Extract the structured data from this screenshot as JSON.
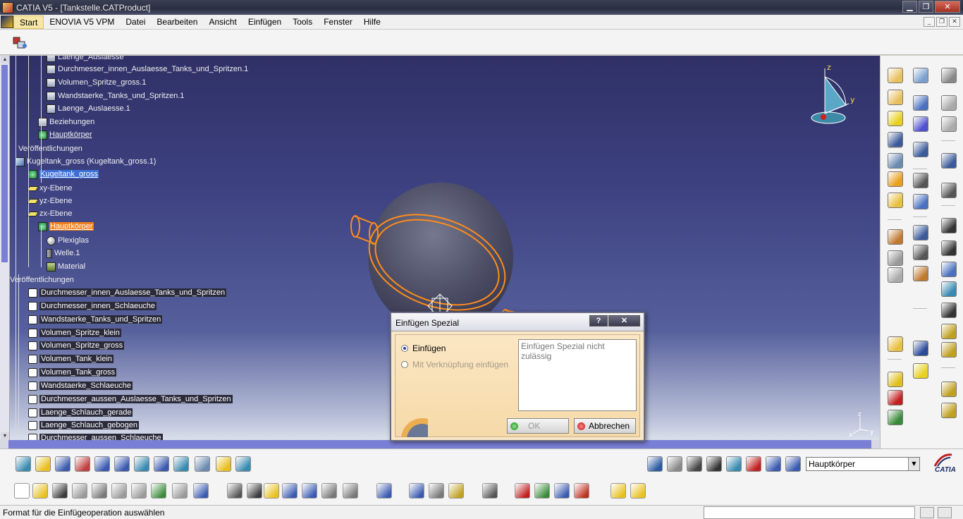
{
  "window": {
    "title": "CATIA V5 - [Tankstelle.CATProduct]",
    "minimize": "▁",
    "maximize": "❐",
    "close": "✕"
  },
  "menubar": {
    "items": [
      "Start",
      "ENOVIA V5 VPM",
      "Datei",
      "Bearbeiten",
      "Ansicht",
      "Einfügen",
      "Tools",
      "Fenster",
      "Hilfe"
    ],
    "active": "Start",
    "mdi_minimize": "_",
    "mdi_restore": "❐",
    "mdi_close": "✕"
  },
  "tree": {
    "nodes": [
      {
        "label": "Laenge_Auslaesse",
        "kind": "formula",
        "style": ""
      },
      {
        "label": "Durchmesser_innen_Auslaesse_Tanks_und_Spritzen.1",
        "kind": "formula",
        "style": ""
      },
      {
        "label": "Volumen_Spritze_gross.1",
        "kind": "formula",
        "style": ""
      },
      {
        "label": "Wandstaerke_Tanks_und_Spritzen.1",
        "kind": "formula",
        "style": ""
      },
      {
        "label": "Laenge_Auslaesse.1",
        "kind": "formula",
        "style": ""
      },
      {
        "label": "Beziehungen",
        "kind": "formula",
        "style": ""
      },
      {
        "label": "Hauptkörper",
        "kind": "body",
        "style": "underline"
      },
      {
        "label": "Veröffentlichungen",
        "kind": "none",
        "style": ""
      },
      {
        "label": "Kugeltank_gross (Kugeltank_gross.1)",
        "kind": "part",
        "style": ""
      },
      {
        "label": "Kugeltank_gross",
        "kind": "body",
        "style": "sel-blue"
      },
      {
        "label": "xy-Ebene",
        "kind": "plane",
        "style": ""
      },
      {
        "label": "yz-Ebene",
        "kind": "plane",
        "style": ""
      },
      {
        "label": "zx-Ebene",
        "kind": "plane",
        "style": ""
      },
      {
        "label": "Hauptkörper",
        "kind": "body",
        "style": "sel-orange"
      },
      {
        "label": "Plexiglas",
        "kind": "sphere",
        "style": ""
      },
      {
        "label": "Welle.1",
        "kind": "shaft",
        "style": ""
      },
      {
        "label": "Material",
        "kind": "mat",
        "style": ""
      },
      {
        "label": "Veröffentlichungen",
        "kind": "none",
        "style": ""
      },
      {
        "label": "Durchmesser_innen_Auslaesse_Tanks_und_Spritzen",
        "kind": "param",
        "style": "dark"
      },
      {
        "label": "Durchmesser_innen_Schlaeuche",
        "kind": "param",
        "style": "dark"
      },
      {
        "label": "Wandstaerke_Tanks_und_Spritzen",
        "kind": "param",
        "style": "dark"
      },
      {
        "label": "Volumen_Spritze_klein",
        "kind": "param",
        "style": "dark"
      },
      {
        "label": "Volumen_Spritze_gross",
        "kind": "param",
        "style": "dark"
      },
      {
        "label": "Volumen_Tank_klein",
        "kind": "param",
        "style": "dark"
      },
      {
        "label": "Volumen_Tank_gross",
        "kind": "param",
        "style": "dark"
      },
      {
        "label": "Wandstaerke_Schlaeuche",
        "kind": "param",
        "style": "dark"
      },
      {
        "label": "Durchmesser_aussen_Auslaesse_Tanks_und_Spritzen",
        "kind": "param",
        "style": "dark"
      },
      {
        "label": "Laenge_Schlauch_gerade",
        "kind": "param",
        "style": "dark"
      },
      {
        "label": "Laenge_Schlauch_gebogen",
        "kind": "param",
        "style": "dark"
      },
      {
        "label": "Durchmesser_aussen_Schlaeuche",
        "kind": "param",
        "style": "dark"
      }
    ]
  },
  "compass": {
    "z": "z",
    "y": "y"
  },
  "mini_axis": {
    "z": "z",
    "x": "x",
    "y": "y"
  },
  "dialog": {
    "title": "Einfügen Spezial",
    "help": "?",
    "close": "✕",
    "option_paste": "Einfügen",
    "option_link": "Mit Verknüpfung einfügen",
    "message": "Einfügen Spezial nicht zulässig",
    "ok": "OK",
    "cancel": "Abbrechen"
  },
  "bottom": {
    "current_layer": "Hauptkörper",
    "logo_text": "CATIA"
  },
  "status": {
    "message": "Format für die Einfügeoperation auswählen"
  },
  "colors": {
    "selection_blue": "#3c6ed8",
    "selection_orange": "#f07f1c",
    "wireframe_orange": "#ff8c1a",
    "dialog_bg": "#f8e8c8"
  }
}
